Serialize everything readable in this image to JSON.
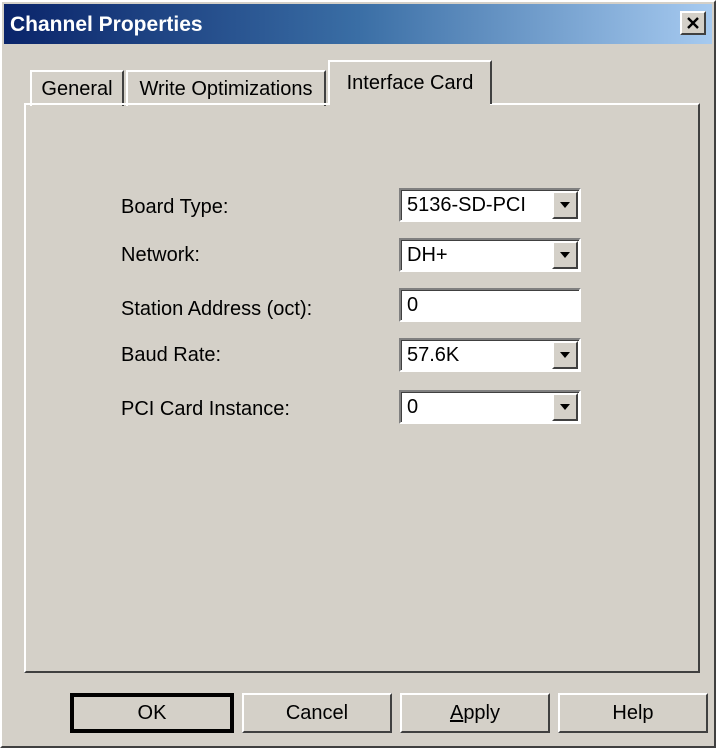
{
  "window": {
    "title": "Channel Properties"
  },
  "tabs": [
    {
      "label": "General",
      "active": false
    },
    {
      "label": "Write Optimizations",
      "active": false
    },
    {
      "label": "Interface Card",
      "active": true
    }
  ],
  "form": {
    "board_type": {
      "label": "Board Type:",
      "value": "5136-SD-PCI"
    },
    "network": {
      "label": "Network:",
      "value": "DH+"
    },
    "station_address": {
      "label": "Station Address (oct):",
      "value": "0"
    },
    "baud_rate": {
      "label": "Baud Rate:",
      "value": "57.6K"
    },
    "pci_card_instance": {
      "label": "PCI Card Instance:",
      "value": "0"
    }
  },
  "buttons": {
    "ok": "OK",
    "cancel": "Cancel",
    "apply_accel": "A",
    "apply_rest": "pply",
    "help": "Help"
  },
  "icons": {
    "close": "close-icon",
    "dropdown": "chevron-down-icon"
  },
  "colors": {
    "face": "#d4d0c8",
    "title_start": "#0a246a",
    "title_end": "#a6caf0"
  }
}
